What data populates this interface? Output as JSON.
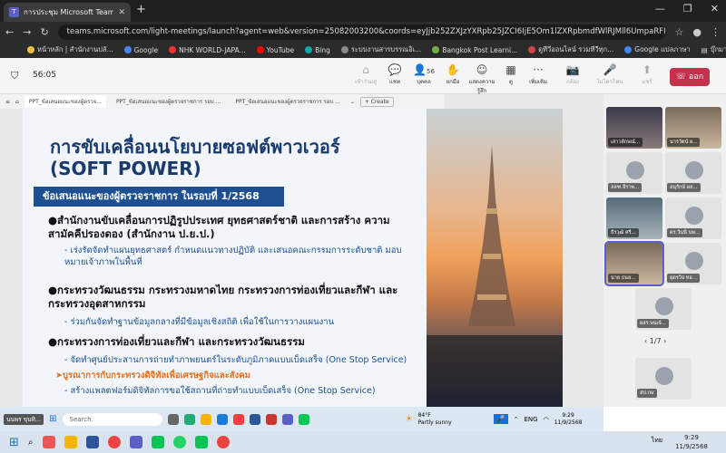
{
  "browser": {
    "tab_title": "การประชุม Microsoft Teams | Microsoft Teams",
    "new_tab_symbol": "+",
    "url": "teams.microsoft.com/light-meetings/launch?agent=web&version=25082003200&coords=eyJjb252ZXJzYXRpb25JZCI6IjE5Om1lZXRpbmdfWlRJMll6UmpaRFI0T1RZM1ppMDBZekF5TFRne...",
    "bookmarks": [
      "หน้าหลัก | สำนักงานปลั...",
      "Google",
      "NHK WORLD-JAPA...",
      "YouTube",
      "Bing",
      "ระบบงานสารบรรณอิเ...",
      "Bangkok Post Learni...",
      "ดูทีวีออนไลน์ รวมทีวีทุก...",
      "Google แปลภาษา"
    ],
    "bookmarks_more": "บุ๊กมาร์กทั้งหมด"
  },
  "meeting": {
    "timer": "56:05",
    "toolbar": [
      {
        "label": "เข้าร่วมสู่",
        "glyph": "⌂",
        "dim": true
      },
      {
        "label": "แชท",
        "glyph": "💬",
        "dim": false
      },
      {
        "label": "บุคคล",
        "glyph": "👤",
        "count": "56",
        "dim": false
      },
      {
        "label": "ยกมือ",
        "glyph": "✋",
        "dim": false
      },
      {
        "label": "แสดงความรู้สึก",
        "glyph": "☺",
        "dim": false
      },
      {
        "label": "ดู",
        "glyph": "▦",
        "dim": false
      },
      {
        "label": "เพิ่มเติม",
        "glyph": "···",
        "dim": false
      },
      {
        "label": "กล้อง",
        "glyph": "📷",
        "dim": true
      },
      {
        "label": "ไมโครโฟน",
        "glyph": "🎤",
        "dim": true
      },
      {
        "label": "แชร์",
        "glyph": "⬆",
        "dim": true
      }
    ],
    "leave_label": "ออก"
  },
  "share_tabs": [
    "PPT_ข้อเสนอแนะของผู้ตรวจ...",
    "PPT_ข้อเสนอแนะของผู้ตรวจราชการ รอบ ...",
    "PPT_ข้อเสนอแนะของผู้ตรวจราชการ รอบ ..."
  ],
  "create_label": "+ Create",
  "slide": {
    "title1": "การขับเคลื่อนนโยบายซอฟต์พาวเวอร์",
    "title2": "(SOFT POWER)",
    "banner": "ข้อเสนอแนะของผู้ตรวจราชการ ในรอบที่ 1/2568",
    "bullets": [
      {
        "text": "●สำนักงานขับเคลื่อนการปฏิรูปประเทศ ยุทธศาสตร์ชาติ และการสร้าง ความสามัคคีปรองดอง (สำนักงาน ป.ย.ป.)",
        "subs": [
          "- เร่งรัดจัดทำแผนยุทธศาสตร์ กำหนดแนวทางปฏิบัติ และเสนอคณะกรรมการระดับชาติ มอบหมายเจ้าภาพในพื้นที่"
        ]
      },
      {
        "text": "●กระทรวงวัฒนธรรม กระทรวงมหาดไทย กระทรวงการท่องเที่ยวและกีฬา และกระทรวงอุตสาหกรรม",
        "subs": [
          "- ร่วมกันจัดทำฐานข้อมูลกลางที่มีข้อมูลเชิงสถิติ เพื่อใช้ในการวางแผนงาน"
        ]
      },
      {
        "text": "●กระทรวงการท่องเที่ยวและกีฬา และกระทรวงวัฒนธรรม",
        "subs": [
          "- จัดทำศูนย์ประสานการถ่ายทำภาพยนตร์ในระดับภูมิภาคแบบเบ็ดเสร็จ (One Stop Service)"
        ]
      }
    ],
    "highlight": "➤บูรณาการกับกระทรวงดิจิทัลเพื่อเศรษฐกิจและสังคม",
    "last_sub": "- สร้างแพลตฟอร์มดิจิทัลการขอใช้สถานที่ถ่ายทำแบบเบ็ดเสร็จ (One Stop Service)",
    "page_number": "12"
  },
  "participants": [
    {
      "name": "เสาวลักษณ์...",
      "style": "video1"
    },
    {
      "name": "นารวัตน์ ผ...",
      "style": "video2"
    },
    {
      "name": "ลลฑ.จีราพ...",
      "style": "avatar"
    },
    {
      "name": "อนุรักษ์ ผล...",
      "style": "avatar"
    },
    {
      "name": "ธีรวุฒิ ศรี...",
      "style": "video3"
    },
    {
      "name": "ดร.วีนนี่ นพ...",
      "style": "avatar"
    },
    {
      "name": "นาย ธนล...",
      "style": "video2",
      "active": true
    },
    {
      "name": "ยุดรวิจ ทอ...",
      "style": "avatar"
    },
    {
      "name": "ผลร.พนเจ้...",
      "style": "avatar"
    },
    {
      "name": "สป.กษ",
      "style": "avatar"
    }
  ],
  "pager": "1/7",
  "inner_taskbar": {
    "user": "นนพร ขุนทิ...",
    "search_placeholder": "Search",
    "weather_temp": "84°F",
    "weather_desc": "Partly sunny",
    "lang": "ENG",
    "time": "9:29",
    "date": "11/9/2568"
  },
  "os_taskbar": {
    "lang": "ไทย",
    "time": "9:29",
    "date": "11/9/2568"
  }
}
